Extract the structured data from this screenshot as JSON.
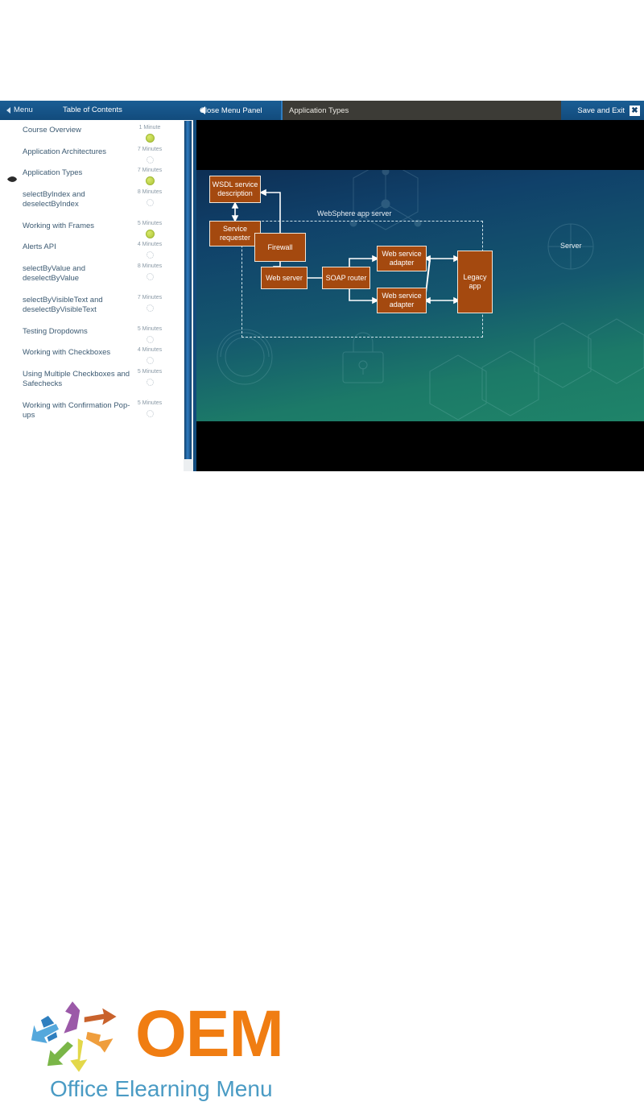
{
  "player": {
    "topbar": {
      "menu_label": "Menu",
      "toc_title": "Table of Contents",
      "close_panel_label": "Close Menu Panel",
      "current_tab": "Application Types",
      "save_exit_label": "Save and Exit",
      "close_icon_glyph": "✖"
    },
    "menu_items": [
      {
        "label": "Course Overview",
        "time": "1 Minute",
        "status": "done",
        "current": false
      },
      {
        "label": "Application Architectures",
        "time": "7 Minutes",
        "status": "todo",
        "current": false
      },
      {
        "label": "Application Types",
        "time": "7 Minutes",
        "status": "done",
        "current": true
      },
      {
        "label": "selectByIndex and deselectByIndex",
        "time": "8 Minutes",
        "status": "todo",
        "current": false
      },
      {
        "label": "Working with Frames",
        "time": "5 Minutes",
        "status": "done",
        "current": false
      },
      {
        "label": "Alerts API",
        "time": "4 Minutes",
        "status": "todo",
        "current": false
      },
      {
        "label": "selectByValue and deselectByValue",
        "time": "8 Minutes",
        "status": "todo",
        "current": false
      },
      {
        "label": "selectByVisibleText and deselectByVisibleText",
        "time": "7 Minutes",
        "status": "todo",
        "current": false
      },
      {
        "label": "Testing Dropdowns",
        "time": "5 Minutes",
        "status": "todo",
        "current": false
      },
      {
        "label": "Working with Checkboxes",
        "time": "4 Minutes",
        "status": "todo",
        "current": false
      },
      {
        "label": "Using Multiple Checkboxes and Safechecks",
        "time": "5 Minutes",
        "status": "todo",
        "current": false
      },
      {
        "label": "Working with Confirmation Pop-ups",
        "time": "5 Minutes",
        "status": "todo",
        "current": false
      }
    ],
    "slide": {
      "container_label": "WebSphere app server",
      "server_label": "Server",
      "nodes": [
        {
          "id": "wsdl",
          "label": "WSDL service description"
        },
        {
          "id": "requester",
          "label": "Service requester"
        },
        {
          "id": "firewall",
          "label": "Firewall"
        },
        {
          "id": "webserver",
          "label": "Web server"
        },
        {
          "id": "soap",
          "label": "SOAP router"
        },
        {
          "id": "adapter1",
          "label": "Web service adapter"
        },
        {
          "id": "adapter2",
          "label": "Web service adapter"
        },
        {
          "id": "legacy",
          "label": "Legacy app"
        }
      ],
      "colors": {
        "box_fill": "#a4490f",
        "box_border": "#f0e5d8",
        "connector": "#ffffff",
        "bg_top": "#0d2f55",
        "bg_bottom": "#1f8469"
      }
    }
  },
  "logo": {
    "wordmark": "OEM",
    "tagline": "Office Elearning Menu",
    "wordmark_color": "#f07d12",
    "tagline_color": "#4a9bc4",
    "arrow_colors": [
      "#2f7fbf",
      "#9b59a8",
      "#c9622c",
      "#ef9e3d",
      "#e3d84a",
      "#7ab648",
      "#55a8dc",
      "#4aa3d8"
    ]
  }
}
